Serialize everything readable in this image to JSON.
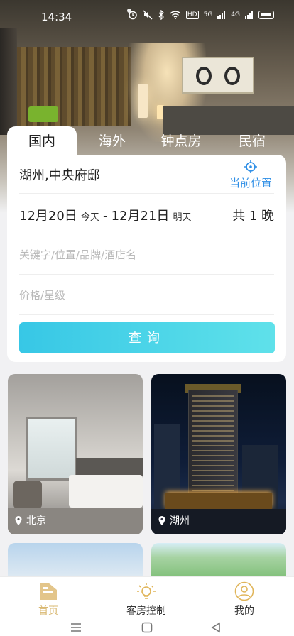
{
  "status_bar": {
    "time": "14:34",
    "hd": "HD",
    "net1": "5G",
    "net2": "4G"
  },
  "tabs": [
    {
      "label": "国内",
      "active": true
    },
    {
      "label": "海外",
      "active": false
    },
    {
      "label": "钟点房",
      "active": false
    },
    {
      "label": "民宿",
      "active": false
    }
  ],
  "search": {
    "location": "湖州,中央府邸",
    "current_location_label": "当前位置",
    "check_in": "12月20日",
    "check_in_sub": "今天",
    "separator": "-",
    "check_out": "12月21日",
    "check_out_sub": "明天",
    "nights": "共 1 晚",
    "keyword_placeholder": "关键字/位置/品牌/酒店名",
    "price_placeholder": "价格/星级",
    "button": "查询"
  },
  "destinations": [
    {
      "city": "北京"
    },
    {
      "city": "湖州"
    }
  ],
  "nav": {
    "home": "首页",
    "room_control": "客房控制",
    "mine": "我的"
  },
  "colors": {
    "accent": "#2d8ee6",
    "nav_active": "#d9b872",
    "button_start": "#37c7e6",
    "button_end": "#5fe1ea"
  }
}
